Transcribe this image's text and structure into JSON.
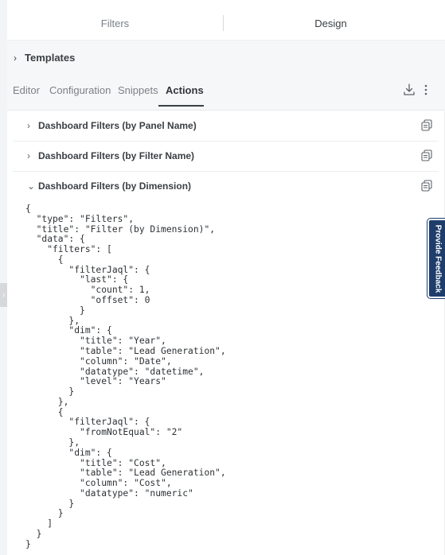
{
  "mode_tabs": {
    "filters": "Filters",
    "design": "Design"
  },
  "templates": {
    "label": "Templates"
  },
  "editor_tabs": [
    {
      "label": "Editor"
    },
    {
      "label": "Configuration"
    },
    {
      "label": "Snippets"
    },
    {
      "label": "Actions",
      "active": true
    }
  ],
  "actions": [
    {
      "title": "Dashboard Filters (by Panel Name)",
      "expanded": false
    },
    {
      "title": "Dashboard Filters (by Filter Name)",
      "expanded": false
    },
    {
      "title": "Dashboard Filters (by Dimension)",
      "expanded": true
    }
  ],
  "code": "{\n  \"type\": \"Filters\",\n  \"title\": \"Filter (by Dimension)\",\n  \"data\": {\n    \"filters\": [\n      {\n        \"filterJaql\": {\n          \"last\": {\n            \"count\": 1,\n            \"offset\": 0\n          }\n        },\n        \"dim\": {\n          \"title\": \"Year\",\n          \"table\": \"Lead Generation\",\n          \"column\": \"Date\",\n          \"datatype\": \"datetime\",\n          \"level\": \"Years\"\n        }\n      },\n      {\n        \"filterJaql\": {\n          \"fromNotEqual\": \"2\"\n        },\n        \"dim\": {\n          \"title\": \"Cost\",\n          \"table\": \"Lead Generation\",\n          \"column\": \"Cost\",\n          \"datatype\": \"numeric\"\n        }\n      }\n    ]\n  }\n}",
  "feedback": {
    "label": "Provide Feedback"
  },
  "icons": {
    "download": "download-icon",
    "more": "more-vertical-icon",
    "copy": "copy-icon",
    "chevron_right": "chevron-right-icon",
    "chevron_down": "chevron-down-icon"
  },
  "colors": {
    "feedback_bg": "#1e3d6b",
    "panel_header_bg": "#f6f7f8",
    "text": "#3a3f44",
    "muted": "#7b8187"
  }
}
